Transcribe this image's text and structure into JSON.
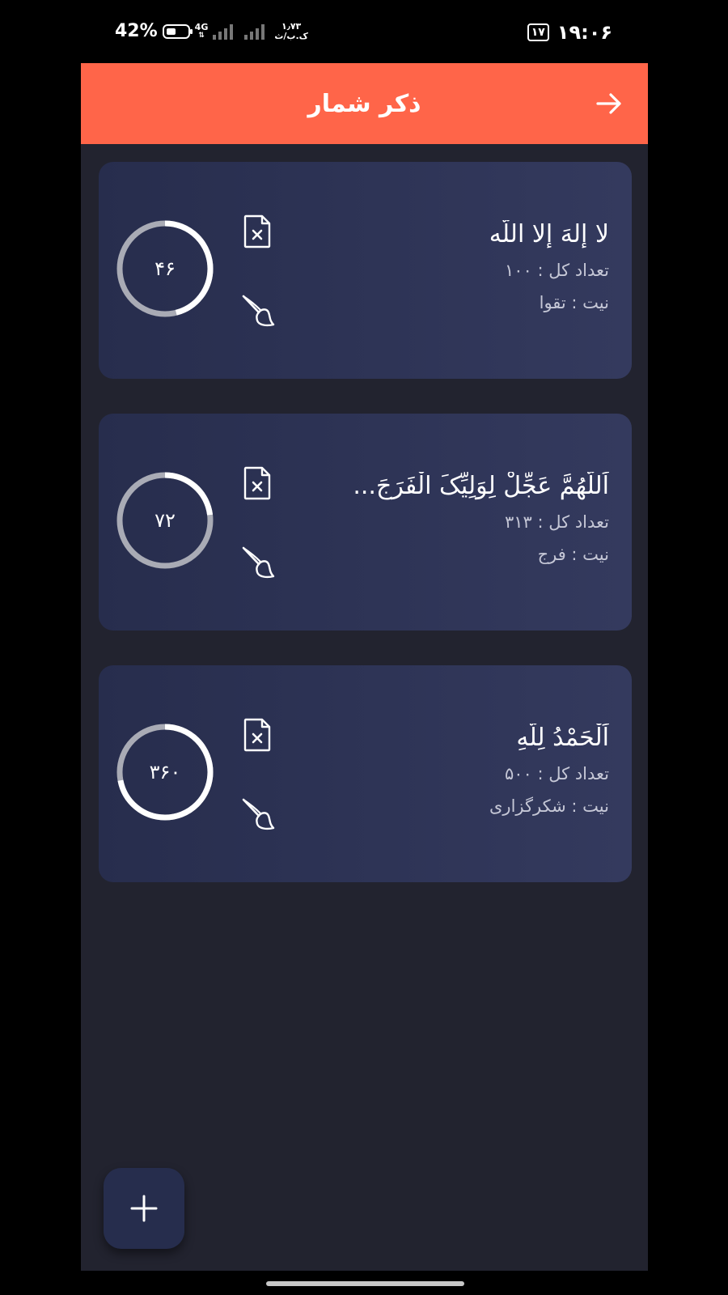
{
  "status_bar": {
    "battery_percent": "42%",
    "battery_level": 0.42,
    "network": "4G",
    "speed_value": "۱٫۷۳",
    "speed_unit": "ک.ب/ث",
    "notification_count": "۱۷",
    "time": "۱۹:۰۶"
  },
  "app_bar": {
    "title": "ذکر شمار"
  },
  "cards": [
    {
      "dhikr": "لا إِلهَ إِلا اللّه",
      "total": "تعداد کل : ۱۰۰",
      "intent": "نیت : تقوا",
      "count": "۴۶",
      "progress": 0.46
    },
    {
      "dhikr": "اَللّهُمَّ عَجِّلْ لِوَلِیِّکَ الْفَرَجَ...",
      "total": "تعداد کل : ۳۱۳",
      "intent": "نیت : فرج",
      "count": "۷۲",
      "progress": 0.23
    },
    {
      "dhikr": "اَلْحَمْدُ لِلَّهِ",
      "total": "تعداد کل : ۵۰۰",
      "intent": "نیت : شکرگزاری",
      "count": "۳۶۰",
      "progress": 0.72
    }
  ],
  "colors": {
    "accent": "#ff6549",
    "background": "#22232f",
    "card": "#2c3254",
    "ring_track": "#a9abb5",
    "ring_progress": "#ffffff"
  },
  "icons": {
    "back": "arrow-right-icon",
    "delete": "file-x-icon",
    "edit_color": "paint-brush-icon",
    "add": "plus-icon"
  }
}
